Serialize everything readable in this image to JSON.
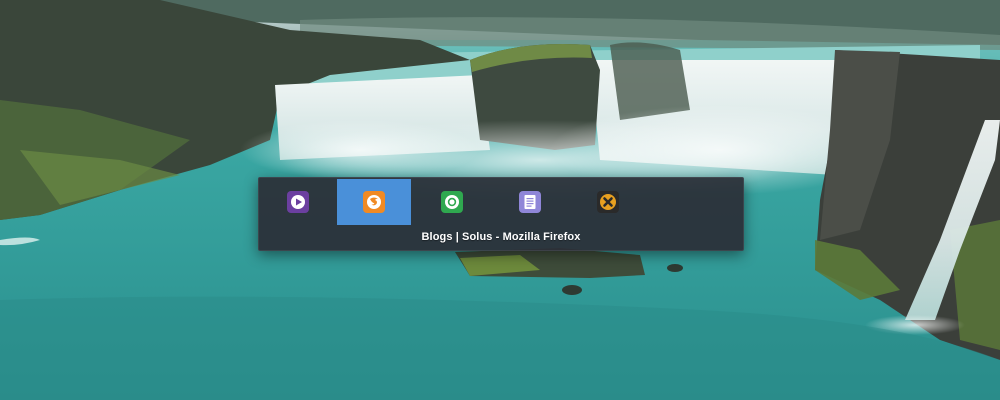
{
  "wallpaper": {
    "description_icon": "waterfall-landscape",
    "colors": {
      "water": "#3aa7a3",
      "mist": "#d9e8e8",
      "rock": "#3a4a3e",
      "moss": "#5d7a3a"
    }
  },
  "switcher": {
    "background": "#2b2e37",
    "selected_color": "#4a90d9",
    "active_title": "Blogs | Solus - Mozilla Firefox",
    "items": [
      {
        "app": "media-player",
        "icon": "play-circle-icon",
        "color": "#6b3fa0",
        "selected": false
      },
      {
        "app": "firefox",
        "icon": "firefox-icon",
        "color": "#f08a24",
        "selected": true
      },
      {
        "app": "chrome",
        "icon": "chrome-icon",
        "color": "#2fa84f",
        "selected": false
      },
      {
        "app": "text-editor",
        "icon": "document-icon",
        "color": "#8f86d8",
        "selected": false
      },
      {
        "app": "utility",
        "icon": "x-close-icon",
        "color": "#e8a020",
        "selected": false
      }
    ]
  }
}
